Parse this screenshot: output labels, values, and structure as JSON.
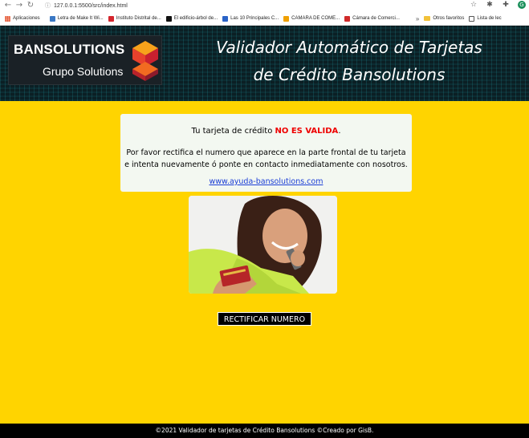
{
  "browser": {
    "url": "127.0.0.1:5500/src/index.html",
    "bookmarks": [
      {
        "label": "Aplicaciones",
        "color": "#e34c26"
      },
      {
        "label": "Letra de Make It Wi...",
        "color": "#3a78c4"
      },
      {
        "label": "Instituto Distrital de...",
        "color": "#d4262d"
      },
      {
        "label": "El edificio-árbol de...",
        "color": "#111111"
      },
      {
        "label": "Las 10 Principales C...",
        "color": "#2a63c7"
      },
      {
        "label": "CAMARA DE COME...",
        "color": "#f0a000"
      },
      {
        "label": "Cámara de Comerci...",
        "color": "#d02a2a"
      }
    ],
    "other_bookmarks": "Otros favoritos",
    "reading_list": "Lista de lec",
    "profile_initial": "G"
  },
  "header": {
    "brand_main": "BANSOLUTIONS",
    "brand_sub": "Grupo Solutions",
    "title_line1": "Validador Automático de Tarjetas",
    "title_line2": "de Crédito Bansolutions"
  },
  "message": {
    "prefix": "Tu tarjeta de crédito ",
    "status": "NO ES VALIDA",
    "suffix": ".",
    "body_line1": "Por favor rectifica el numero que aparece en la parte frontal de tu tarjeta",
    "body_line2": "e intenta nuevamente ó ponte en contacto inmediatamente con nosotros.",
    "link": "www.ayuda-bansolutions.com"
  },
  "button": {
    "label": "RECTIFICAR NUMERO"
  },
  "footer": {
    "text": "©2021 Validador de tarjetas de Crédito Bansolutions ©Creado por GisB."
  },
  "colors": {
    "page_bg": "#ffd400",
    "status_red": "#ee0000",
    "link_blue": "#1a3dd6"
  }
}
